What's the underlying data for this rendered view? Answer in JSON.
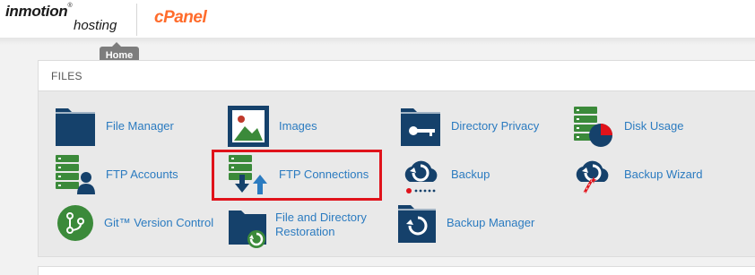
{
  "header": {
    "brand_name": "inmotion",
    "brand_tm": "®",
    "brand_sub": "hosting",
    "cpanel_logo": "cPanel",
    "tooltip": "Home"
  },
  "files_section": {
    "title": "FILES",
    "items": [
      {
        "label": "File Manager",
        "icon": "folder-icon"
      },
      {
        "label": "Images",
        "icon": "image-icon"
      },
      {
        "label": "Directory Privacy",
        "icon": "folder-key-icon"
      },
      {
        "label": "Disk Usage",
        "icon": "disk-usage-icon"
      },
      {
        "label": "FTP Accounts",
        "icon": "ftp-accounts-icon"
      },
      {
        "label": "FTP Connections",
        "icon": "ftp-connections-icon"
      },
      {
        "label": "Backup",
        "icon": "backup-cloud-icon"
      },
      {
        "label": "Backup Wizard",
        "icon": "backup-wizard-icon"
      },
      {
        "label": "Git™ Version Control",
        "icon": "git-icon"
      },
      {
        "label_line1": "File and Directory",
        "label_line2": "Restoration",
        "icon": "file-restore-icon"
      },
      {
        "label": "Backup Manager",
        "icon": "backup-manager-icon"
      }
    ]
  },
  "colors": {
    "link": "#2b7bc0",
    "icon_navy": "#15416b",
    "icon_green": "#3b8a3a",
    "highlight": "#e0131b",
    "cpanel_orange": "#ff6c2c"
  }
}
